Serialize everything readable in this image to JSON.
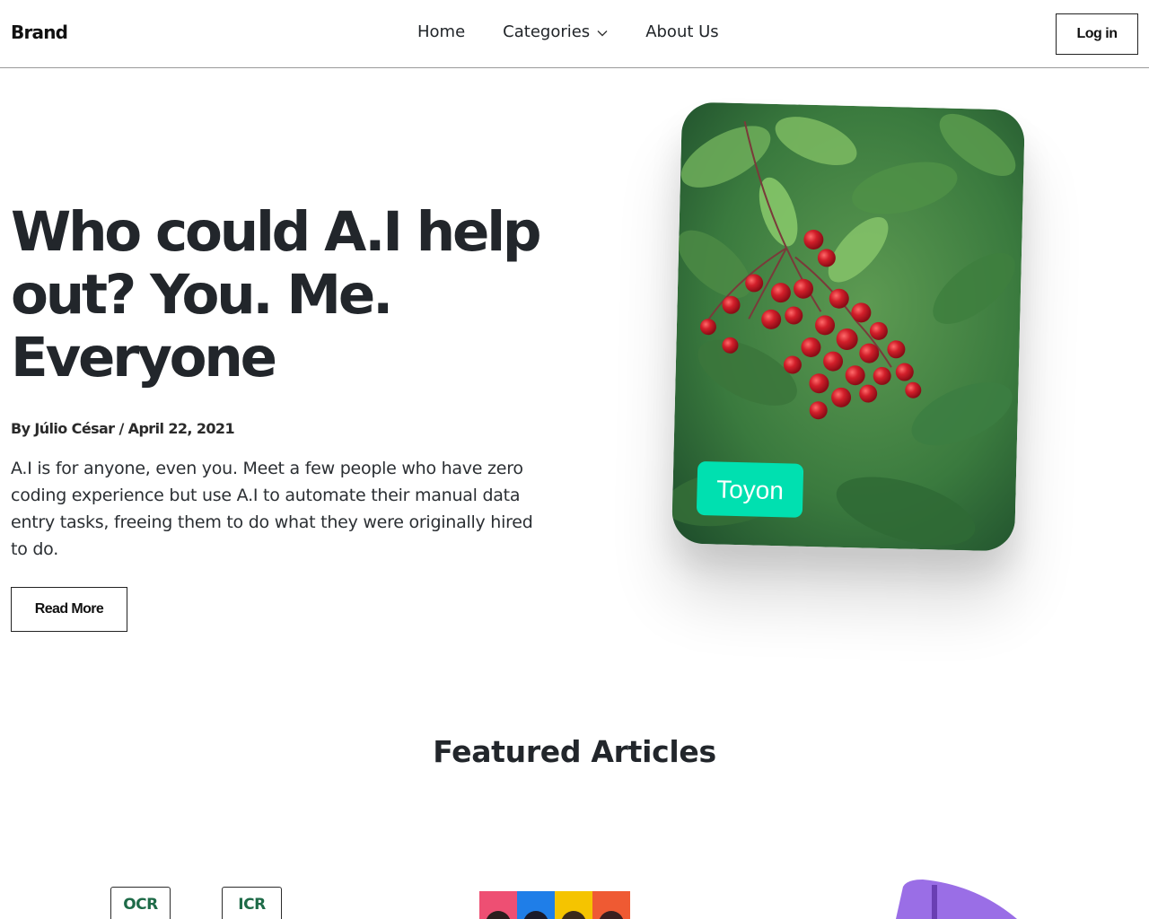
{
  "navbar": {
    "brand": "Brand",
    "links": [
      {
        "label": "Home"
      },
      {
        "label": "Categories"
      },
      {
        "label": "About Us"
      }
    ],
    "login_label": "Log in"
  },
  "hero": {
    "title_line1": "Who could A.I help",
    "title_line2": "out? You. Me.",
    "title_line3": "Everyone",
    "meta": "By Júlio César / April 22, 2021",
    "description": "A.I is for anyone, even you. Meet a few people who have zero coding experience but use A.I to automate their manual data entry tasks, freeing them to do what they were originally hired to do.",
    "read_more_label": "Read More",
    "image_tag": "Toyon"
  },
  "featured": {
    "title": "Featured Articles",
    "card1_tags": [
      "OCR",
      "ICR"
    ]
  },
  "colors": {
    "tag_green": "#00e0b0",
    "tag_text_green": "#1e6b48",
    "berry_red": "#d21f2a",
    "leaf_green": "#3f8a3c",
    "purple": "#9a6ee6"
  },
  "icons": {
    "categories_chevron": "chevron-down-icon"
  }
}
